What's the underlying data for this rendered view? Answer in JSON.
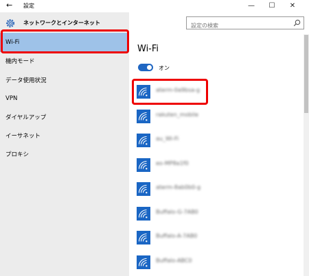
{
  "window": {
    "title": "設定",
    "back_glyph": "←",
    "minimize_glyph": "—",
    "maximize_glyph": "☐",
    "close_glyph": "✕"
  },
  "app": {
    "title": "ネットワークとインターネット",
    "icon": "gear-icon"
  },
  "search": {
    "placeholder": "設定の検索",
    "icon": "search-icon"
  },
  "sidebar": {
    "items": [
      {
        "label": "Wi-Fi",
        "selected": true
      },
      {
        "label": "機内モード",
        "selected": false
      },
      {
        "label": "データ使用状況",
        "selected": false
      },
      {
        "label": "VPN",
        "selected": false
      },
      {
        "label": "ダイヤルアップ",
        "selected": false
      },
      {
        "label": "イーサネット",
        "selected": false
      },
      {
        "label": "プロキシ",
        "selected": false
      }
    ]
  },
  "main": {
    "title": "Wi-Fi",
    "toggle_label": "オン",
    "toggle_on": true,
    "networks": [
      {
        "name": "aterm-0a9bsa-g"
      },
      {
        "name": "rakuten_mobile"
      },
      {
        "name": "au_Wi-Fi"
      },
      {
        "name": "eo-MP8a1f0"
      },
      {
        "name": "aterm-8ab0b0-g"
      },
      {
        "name": "Buffalo-G-7AB0"
      },
      {
        "name": "Buffalo-A-7AB0"
      },
      {
        "name": "Buffalo-ABC0"
      }
    ]
  },
  "colors": {
    "accent": "#1a66c4",
    "selection": "#9ec2e8",
    "highlight_box": "#e00000",
    "sidebar_bg": "#ececec"
  }
}
